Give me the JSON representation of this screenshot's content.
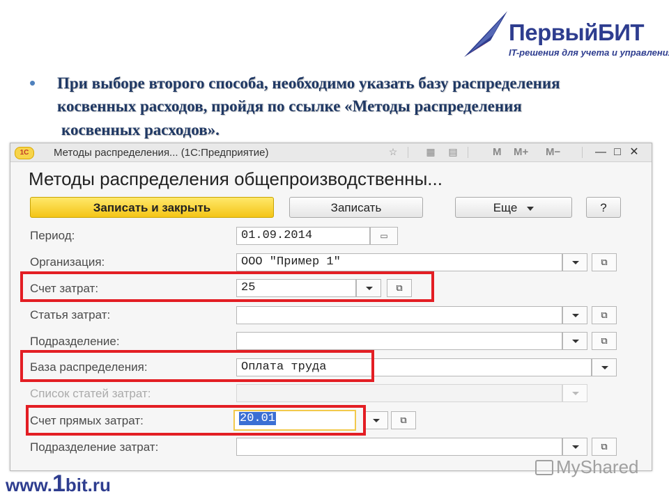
{
  "logo": {
    "name": "ПервыйБИТ",
    "tagline": "IT-решения для учета и управления"
  },
  "slide": {
    "bullet": "•",
    "text_line1": "При выборе второго способа, необходимо указать базу распределения",
    "text_line2": "косвенных расходов, пройдя по ссылке «Методы распределения",
    "text_line3": "косвенных расходов»."
  },
  "window": {
    "app_badge": "1С",
    "title": "Методы распределения... (1С:Предприятие)",
    "toolbar": {
      "m": "M",
      "m_plus": "M+",
      "m_minus": "M−",
      "minimize": "—",
      "maximize": "□",
      "close": "✕"
    },
    "form_title": "Методы распределения общепроизводственны...",
    "buttons": {
      "save_close": "Записать и закрыть",
      "save": "Записать",
      "more": "Еще",
      "help": "?"
    },
    "fields": {
      "period": {
        "label": "Период:",
        "value": "01.09.2014"
      },
      "organization": {
        "label": "Организация:",
        "value": "ООО \"Пример 1\""
      },
      "cost_account": {
        "label": "Счет затрат:",
        "value": "25"
      },
      "cost_item": {
        "label": "Статья затрат:",
        "value": ""
      },
      "department": {
        "label": "Подразделение:",
        "value": ""
      },
      "distribution_base": {
        "label": "База распределения:",
        "value": "Оплата труда"
      },
      "cost_items_list": {
        "label": "Список статей затрат:",
        "value": ""
      },
      "direct_cost_account": {
        "label": "Счет прямых затрат:",
        "value": "20.01"
      },
      "cost_department": {
        "label": "Подразделение затрат:",
        "value": ""
      }
    },
    "highlight_color": "#e31e24"
  },
  "footer": {
    "site_prefix": "www.",
    "site_big": "1",
    "site_suffix": "bit.ru",
    "watermark": "MyShared"
  }
}
